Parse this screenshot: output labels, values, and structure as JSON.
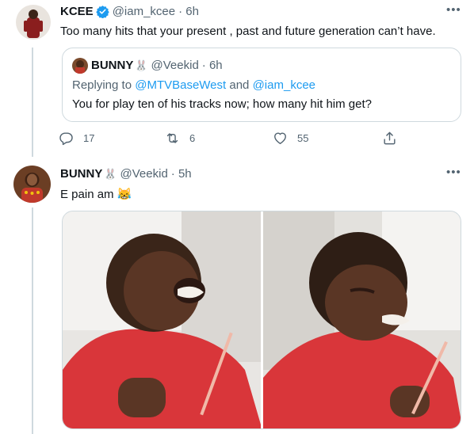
{
  "tweet1": {
    "author_name": "KCEE",
    "handle": "@iam_kcee",
    "time": "· 6h",
    "text": "Too many hits that your present , past and future generation can’t have.",
    "quote": {
      "author_name": "BUNNY",
      "handle": "@Veekid",
      "time": "· 6h",
      "replying_prefix": "Replying to",
      "replying_to_1": "@MTVBaseWest",
      "replying_and": "and",
      "replying_to_2": "@iam_kcee",
      "text": "You for play ten of his tracks now; how many hit him get?"
    },
    "actions": {
      "replies": "17",
      "retweets": "6",
      "likes": "55"
    }
  },
  "tweet2": {
    "author_name": "BUNNY",
    "handle": "@Veekid",
    "time": "· 5h",
    "text": "E pain am",
    "emoji": "😹"
  },
  "icons": {
    "verified": "verified-badge-icon",
    "rabbit": "rabbit-emoji-icon",
    "reply": "reply-icon",
    "retweet": "retweet-icon",
    "like": "heart-icon",
    "share": "share-icon",
    "more": "more-dots-icon"
  },
  "colors": {
    "accent": "#1d9bf0",
    "secondary_text": "#536471",
    "border": "#cfd9de"
  }
}
